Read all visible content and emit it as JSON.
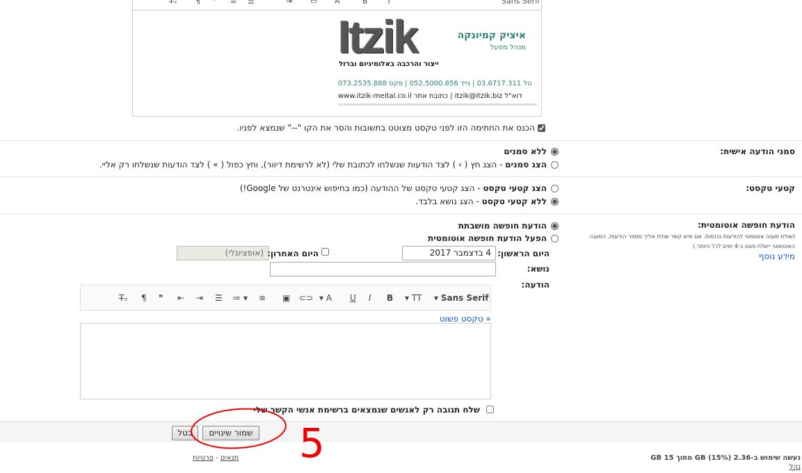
{
  "signature": {
    "toolbar_font": "Sans Serif",
    "logo_text": "Itzik",
    "logo_subtitle": "ייצור והרכבה באלומיניום וברזל",
    "name": "איציק קמיונקה",
    "title": "מנהל מפעל",
    "phones": "טל 03.6717.311 | נייד 052.5000.856 | פקס 073.2535.888",
    "address": "דוא\"ל itzik@itzik.biz | כתובת אתר www.itzik-meital.co.il",
    "insert_before_quote": "הכנס את החתימה הזו לפני טקסט מצוטט בתשובות והסר את הקו \"--\" שנמצא לפניו."
  },
  "personal_level": {
    "label": "סמני הודעה אישית:",
    "opt1": "ללא סמנים",
    "opt2_bold": "הצג סמנים",
    "opt2_rest": " - הצג חץ ( › ) לצד הודעות שנשלחו לכתובת שלי (לא לרשימת דיוור), וחץ כפול ( » ) לצד הודעות שנשלחו רק אליי."
  },
  "snippets": {
    "label": "קטעי טקסט:",
    "opt1_bold": "הצג קטעי טקסט",
    "opt1_rest": " - הצג קטעי טקסט של ההודעה (כמו בחיפוש אינטרנט של Google!)",
    "opt2_bold": "ללא קטעי טקסט",
    "opt2_rest": " - הצג נושא בלבד."
  },
  "vacation": {
    "label": "הודעת חופשה אוטומטית:",
    "desc1": "(שולח מענה אוטומטי להודעות נכנסות. אם איש קשר שולח אליך מספר הודעות, המענה",
    "desc2": "האוטומטי יישלח פעם ב-4 ימים לכל היותר.)",
    "learn_more": "מידע נוסף",
    "off": "הודעת חופשה מושבתת",
    "on": "הפעל הודעת חופשה אוטומטית",
    "first_day_label": "היום הראשון:",
    "first_day_value": "4 בדצמבר 2017",
    "last_day_label": "היום האחרון:",
    "last_day_placeholder": "(אופציונלי)",
    "subject_label": "נושא:",
    "message_label": "הודעה:",
    "plain_text_link": "« טקסט  פשוט",
    "toolbar_font": "Sans Serif",
    "contacts_only": "שלח תגובה רק לאנשים שנמצאים ברשימת אנשי הקשר שלי"
  },
  "buttons": {
    "save": "שמור שינויים",
    "cancel": "בטל"
  },
  "annotation": {
    "number": "5"
  },
  "footer": {
    "storage": "נעשה שימוש ב-2.36 GB (15%) מתוך 15 GB",
    "manage": "נהל",
    "terms": "תנאים",
    "separator": " - ",
    "privacy": "פרטיות"
  }
}
